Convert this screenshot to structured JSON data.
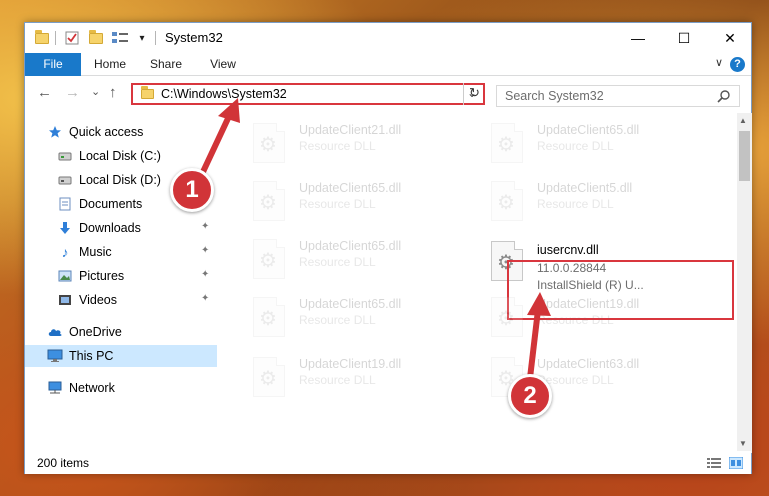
{
  "window": {
    "title": "System32",
    "min_glyph": "—",
    "max_glyph": "☐",
    "close_glyph": "✕",
    "chevron_glyph": "∨"
  },
  "ribbon": {
    "tabs": [
      {
        "label": "File"
      },
      {
        "label": "Home"
      },
      {
        "label": "Share"
      },
      {
        "label": "View"
      }
    ],
    "help_glyph": "?"
  },
  "nav": {
    "back_glyph": "←",
    "forward_glyph": "→",
    "recent_glyph": "⌄",
    "up_glyph": "↑",
    "address": "C:\\Windows\\System32",
    "address_drop_glyph": "⌄",
    "refresh_glyph": "↻",
    "search_placeholder": "Search System32"
  },
  "sidebar": {
    "pin_glyph": "📌",
    "items": [
      {
        "label": "Quick access",
        "icon": "star-icon"
      },
      {
        "label": "Local Disk (C:)",
        "icon": "drive-icon"
      },
      {
        "label": "Local Disk (D:)",
        "icon": "drive-icon"
      },
      {
        "label": "Documents",
        "icon": "documents-icon"
      },
      {
        "label": "Downloads",
        "icon": "download-icon"
      },
      {
        "label": "Music",
        "icon": "music-icon"
      },
      {
        "label": "Pictures",
        "icon": "pictures-icon"
      },
      {
        "label": "Videos",
        "icon": "videos-icon"
      },
      {
        "label": "OneDrive",
        "icon": "cloud-icon"
      },
      {
        "label": "This PC",
        "icon": "computer-icon",
        "selected": true
      },
      {
        "label": "Network",
        "icon": "network-icon"
      }
    ]
  },
  "files": [
    {
      "name": "UpdateClient21.dll",
      "type": "Resource DLL"
    },
    {
      "name": "UpdateClient65.dll",
      "type": "Resource DLL"
    },
    {
      "name": "UpdateClient65.dll",
      "type": "Resource DLL"
    },
    {
      "name": "UpdateClient5.dll",
      "type": "Resource DLL"
    },
    {
      "name": "UpdateClient65.dll",
      "type": "Resource DLL"
    },
    {
      "name": "iusercnv.dll",
      "version": "11.0.0.28844",
      "company": "InstallShield (R) U..."
    },
    {
      "name": "UpdateClient65.dll",
      "type": "Resource DLL"
    },
    {
      "name": "UpdateClient19.dll",
      "type": "Resource DLL"
    },
    {
      "name": "UpdateClient19.dll",
      "type": "Resource DLL"
    },
    {
      "name": "UpdateClient63.dll",
      "type": "Resource DLL"
    }
  ],
  "gear_glyph": "⚙",
  "status": {
    "items_count": "200 items"
  },
  "annotations": {
    "step1": "1",
    "step2": "2"
  },
  "colors": {
    "accent": "#1979ca",
    "highlight": "#d9363e",
    "selected": "#cce8ff"
  }
}
